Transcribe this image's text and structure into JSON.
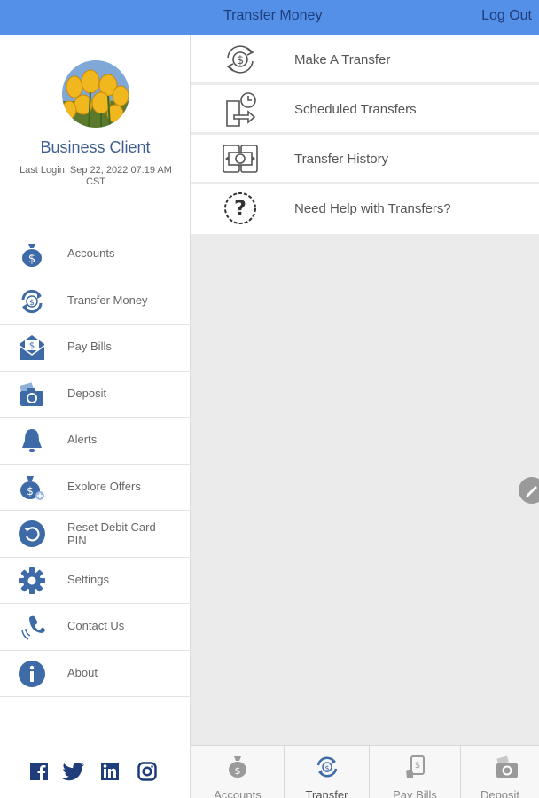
{
  "header": {
    "title": "Transfer Money",
    "logout_label": "Log Out"
  },
  "profile": {
    "name": "Business Client",
    "last_login": "Last Login: Sep 22, 2022 07:19 AM CST"
  },
  "sidebar": {
    "items": [
      {
        "label": "Accounts",
        "icon": "money-bag-icon"
      },
      {
        "label": "Transfer Money",
        "icon": "transfer-icon"
      },
      {
        "label": "Pay Bills",
        "icon": "envelope-dollar-icon"
      },
      {
        "label": "Deposit",
        "icon": "camera-check-icon"
      },
      {
        "label": "Alerts",
        "icon": "bell-icon"
      },
      {
        "label": "Explore Offers",
        "icon": "money-bag-plus-icon"
      },
      {
        "label": "Reset Debit Card PIN",
        "icon": "reset-icon"
      },
      {
        "label": "Settings",
        "icon": "gear-icon"
      },
      {
        "label": "Contact Us",
        "icon": "phone-icon"
      },
      {
        "label": "About",
        "icon": "info-icon"
      }
    ],
    "social": [
      "facebook-icon",
      "twitter-icon",
      "linkedin-icon",
      "instagram-icon"
    ]
  },
  "transfer_options": [
    {
      "label": "Make A Transfer",
      "icon": "transfer-circle-icon"
    },
    {
      "label": "Scheduled Transfers",
      "icon": "scheduled-icon"
    },
    {
      "label": "Transfer History",
      "icon": "history-icon"
    },
    {
      "label": "Need Help with Transfers?",
      "icon": "help-icon"
    }
  ],
  "tabbar": {
    "tabs": [
      {
        "label": "Accounts",
        "icon": "money-bag-icon"
      },
      {
        "label": "Transfer",
        "icon": "transfer-icon",
        "active": true
      },
      {
        "label": "Pay Bills",
        "icon": "pay-bills-icon"
      },
      {
        "label": "Deposit",
        "icon": "camera-check-icon"
      }
    ]
  },
  "colors": {
    "header": "#5590e8",
    "icon_blue": "#3e6ba8",
    "background": "#ebebeb"
  }
}
